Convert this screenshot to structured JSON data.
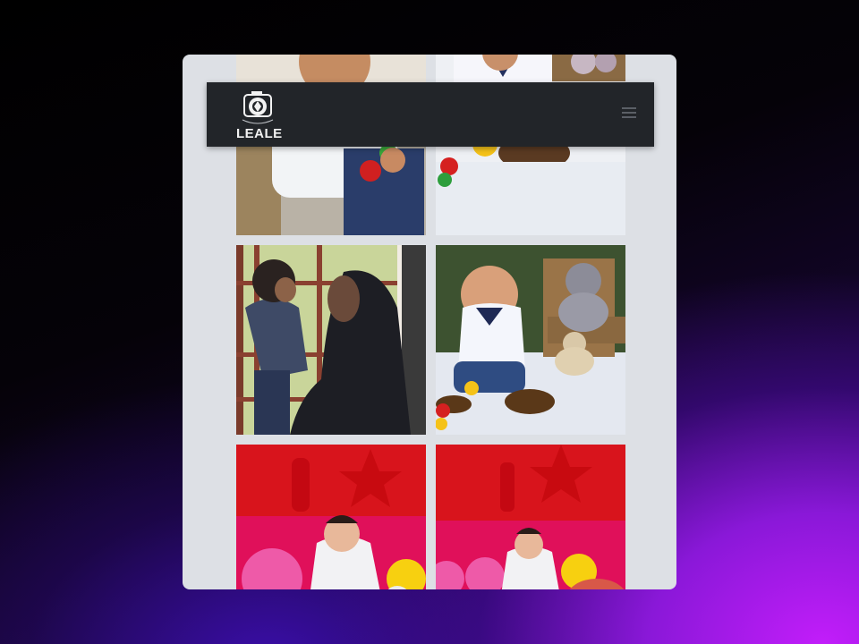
{
  "navbar": {
    "brand_name": "LEALE",
    "logo_icon": "camera-shutter-icon",
    "menu_icon": "hamburger-menu-icon"
  },
  "gallery": {
    "photos": [
      {
        "subject": "baby-playing-toy"
      },
      {
        "subject": "baby-seated-teddy"
      },
      {
        "subject": "mother-holding-baby-silhouette"
      },
      {
        "subject": "smiling-baby-teddy-bears"
      },
      {
        "subject": "baby-red-balloons-closeup"
      },
      {
        "subject": "baby-red-balloons-wide"
      }
    ]
  },
  "colors": {
    "navbar_bg": "#222529",
    "frame_bg": "#dde0e5",
    "accent_red": "#d8141c"
  }
}
